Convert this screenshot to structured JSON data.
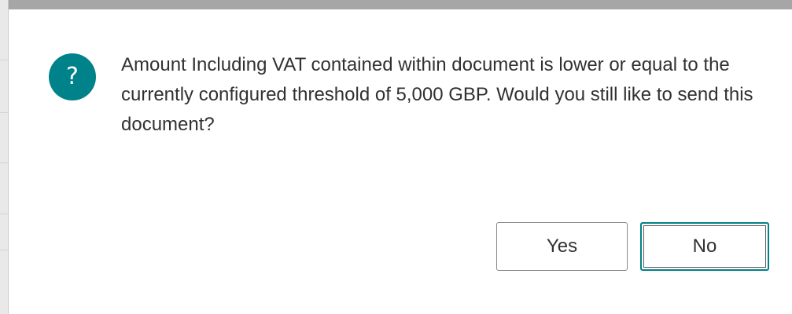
{
  "dialog": {
    "icon": "question-icon",
    "icon_glyph": "?",
    "icon_color": "#00828a",
    "message": "Amount Including VAT contained within document is lower or equal to the currently configured threshold of 5,000 GBP. Would you still like to send this document?",
    "buttons": {
      "yes_label": "Yes",
      "no_label": "No"
    }
  }
}
